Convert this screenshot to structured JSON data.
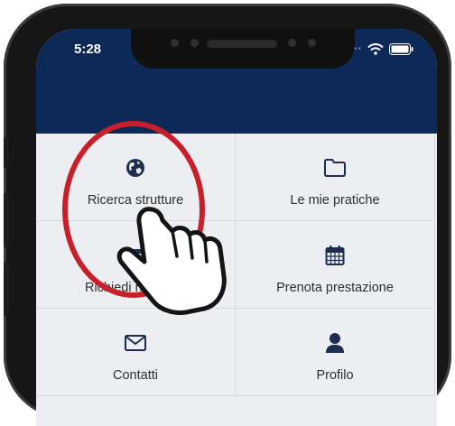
{
  "status_bar": {
    "time": "5:28"
  },
  "colors": {
    "header": "#0c2957",
    "icon": "#1d2e4f",
    "highlight_circle": "#c8202a"
  },
  "menu": [
    {
      "label": "Ricerca strutture",
      "icon": "globe-icon"
    },
    {
      "label": "Le mie pratiche",
      "icon": "folder-icon"
    },
    {
      "label": "Richiedi rimborso",
      "icon": "wallet-icon"
    },
    {
      "label": "Prenota prestazione",
      "icon": "calendar-icon"
    },
    {
      "label": "Contatti",
      "icon": "envelope-icon"
    },
    {
      "label": "Profilo",
      "icon": "user-icon"
    }
  ]
}
